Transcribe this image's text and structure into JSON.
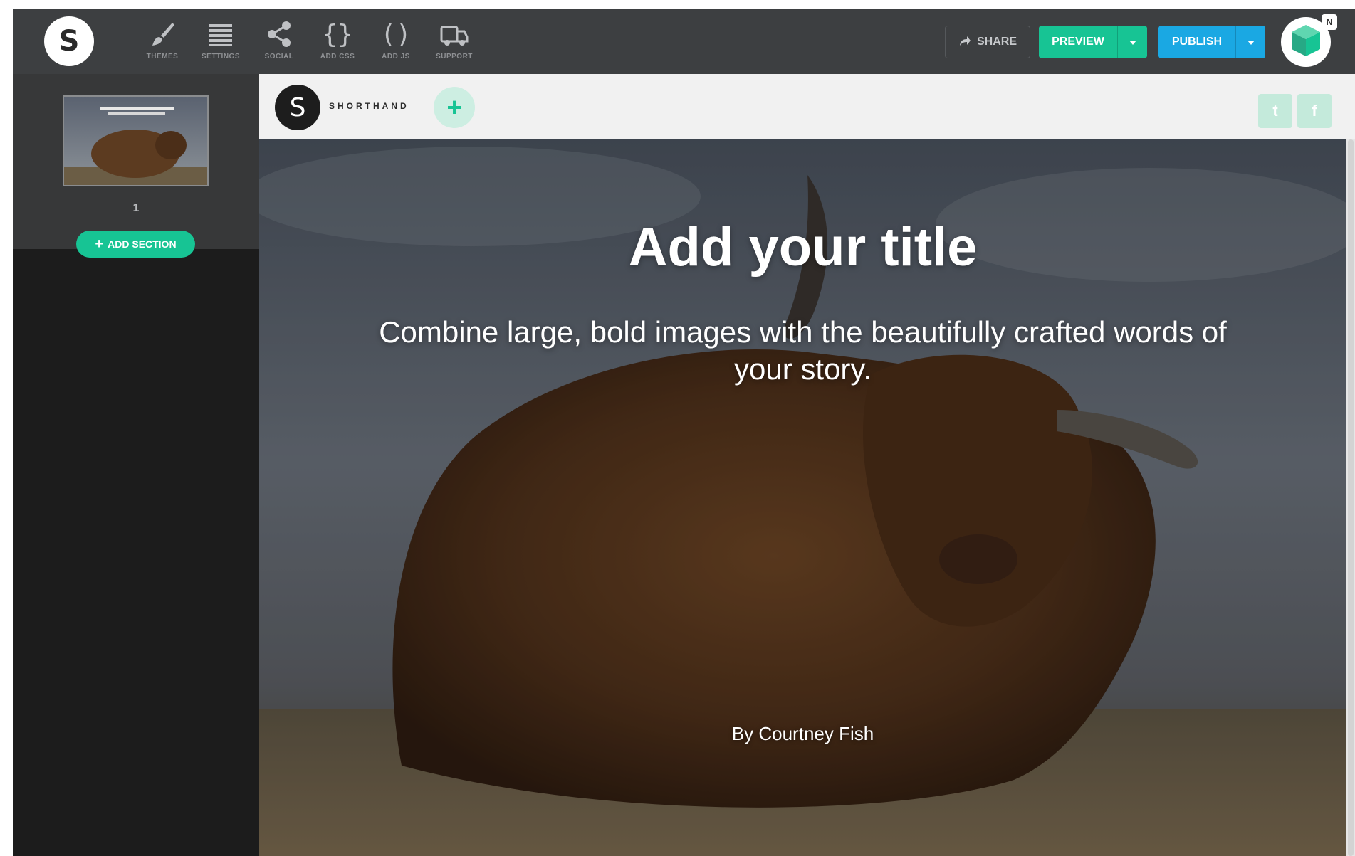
{
  "app": {
    "logo_letter": "S"
  },
  "toolbar": {
    "tools": [
      {
        "label": "THEMES",
        "icon": "brush-icon"
      },
      {
        "label": "SETTINGS",
        "icon": "list-icon"
      },
      {
        "label": "SOCIAL",
        "icon": "share-icon"
      },
      {
        "label": "ADD CSS",
        "icon": "curly-braces-icon"
      },
      {
        "label": "ADD JS",
        "icon": "parentheses-icon"
      },
      {
        "label": "SUPPORT",
        "icon": "support-truck-icon"
      }
    ],
    "share_label": "SHARE",
    "preview_label": "PREVIEW",
    "publish_label": "PUBLISH",
    "notification_badge": "N"
  },
  "sidebar": {
    "sections": [
      {
        "number": "1"
      }
    ],
    "add_section_label": "ADD SECTION"
  },
  "story": {
    "logo_letter": "S",
    "brand": "SHORTHAND",
    "add_symbol": "+",
    "twitter_glyph": "t",
    "facebook_glyph": "f",
    "title": "Add your title",
    "subtitle": "Combine large, bold images with the beautifully crafted words of your story.",
    "byline": "By Courtney Fish"
  },
  "colors": {
    "accent_green": "#17c494",
    "accent_blue": "#1aa8e3",
    "toolbar_bg": "#3d3f41",
    "sidebar_bg": "#1c1c1c"
  }
}
